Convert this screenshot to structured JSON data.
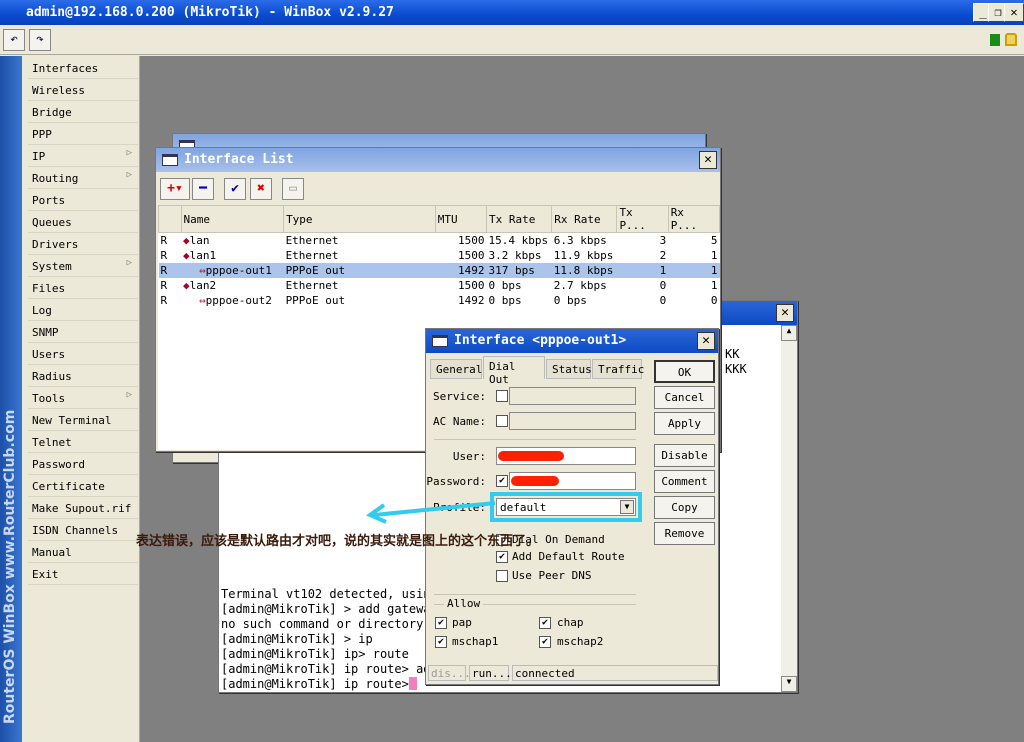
{
  "window_title": "admin@192.168.0.200 (MikroTik) - WinBox v2.9.27",
  "brand_text": "RouterOS WinBox  www.RouterClub.com",
  "menu": [
    {
      "label": "Interfaces"
    },
    {
      "label": "Wireless"
    },
    {
      "label": "Bridge"
    },
    {
      "label": "PPP"
    },
    {
      "label": "IP",
      "submenu": true
    },
    {
      "label": "Routing",
      "submenu": true
    },
    {
      "label": "Ports"
    },
    {
      "label": "Queues"
    },
    {
      "label": "Drivers"
    },
    {
      "label": "System",
      "submenu": true
    },
    {
      "label": "Files"
    },
    {
      "label": "Log"
    },
    {
      "label": "SNMP"
    },
    {
      "label": "Users"
    },
    {
      "label": "Radius"
    },
    {
      "label": "Tools",
      "submenu": true
    },
    {
      "label": "New Terminal"
    },
    {
      "label": "Telnet"
    },
    {
      "label": "Password"
    },
    {
      "label": "Certificate"
    },
    {
      "label": "Make Supout.rif"
    },
    {
      "label": "ISDN Channels"
    },
    {
      "label": "Manual"
    },
    {
      "label": "Exit"
    }
  ],
  "interface_list": {
    "title": "Interface List",
    "columns": [
      "",
      "Name",
      "Type",
      "MTU",
      "Tx Rate",
      "Rx Rate",
      "Tx P...",
      "Rx P..."
    ],
    "rows": [
      {
        "flag": "R",
        "name": "lan",
        "type": "Ethernet",
        "mtu": "1500",
        "tx": "15.4 kbps",
        "rx": "6.3 kbps",
        "txp": "3",
        "rxp": "5"
      },
      {
        "flag": "R",
        "name": "lan1",
        "type": "Ethernet",
        "mtu": "1500",
        "tx": "3.2 kbps",
        "rx": "11.9 kbps",
        "txp": "2",
        "rxp": "1"
      },
      {
        "flag": "R",
        "name": "pppoe-out1",
        "type": "PPPoE out",
        "mtu": "1492",
        "tx": "317 bps",
        "rx": "11.8 kbps",
        "txp": "1",
        "rxp": "1",
        "selected": true
      },
      {
        "flag": "R",
        "name": "lan2",
        "type": "Ethernet",
        "mtu": "1500",
        "tx": "0 bps",
        "rx": "2.7 kbps",
        "txp": "0",
        "rxp": "1"
      },
      {
        "flag": "R",
        "name": "pppoe-out2",
        "type": "PPPoE out",
        "mtu": "1492",
        "tx": "0 bps",
        "rx": "0 bps",
        "txp": "0",
        "rxp": "0"
      }
    ]
  },
  "dialog": {
    "title": "Interface <pppoe-out1>",
    "tabs": [
      "General",
      "Dial Out",
      "Status",
      "Traffic"
    ],
    "active_tab": "Dial Out",
    "service_label": "Service:",
    "ac_name_label": "AC Name:",
    "user_label": "User:",
    "password_label": "Password:",
    "profile_label": "Profile:",
    "profile_value": "default",
    "dial_on_demand": "Dial On Demand",
    "add_default_route": "Add Default Route",
    "use_peer_dns": "Use Peer DNS",
    "allow_label": "Allow",
    "allow": [
      "pap",
      "chap",
      "mschap1",
      "mschap2"
    ],
    "buttons": [
      "OK",
      "Cancel",
      "Apply",
      "Disable",
      "Comment",
      "Copy",
      "Remove"
    ],
    "status": [
      "dis...",
      "run...",
      "connected"
    ]
  },
  "terminal": {
    "lines": [
      "Terminal vt102 detected, usin",
      "[admin@MikroTik] > add gatewa",
      "no such command or directory",
      "[admin@MikroTik] > ip",
      "[admin@MikroTik] ip> route",
      "[admin@MikroTik] ip route> ad",
      "[admin@MikroTik] ip route> "
    ],
    "partial_right": [
      "KK",
      "KKK"
    ]
  },
  "annotation": "表达错误，应该是默认路由才对吧，说的其实就是图上的这个东西了。",
  "colors": {
    "annotation_box": "#33ccee",
    "selected_row": "#aac4ec",
    "redaction": "#ff2200"
  }
}
